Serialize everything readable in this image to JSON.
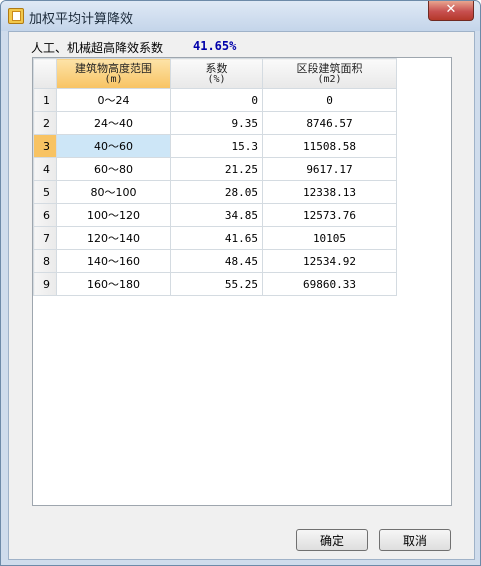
{
  "window": {
    "title": "加权平均计算降效",
    "close_glyph": "✕"
  },
  "summary": {
    "label": "人工、机械超高降效系数",
    "value": "41.65%"
  },
  "table": {
    "columns": [
      {
        "title": "建筑物高度范围",
        "unit": "(m)"
      },
      {
        "title": "系数",
        "unit": "(%)"
      },
      {
        "title": "区段建筑面积",
        "unit": "(m2)"
      }
    ],
    "rows": [
      {
        "no": "1",
        "range": "0～24",
        "coef": "0",
        "area": "0"
      },
      {
        "no": "2",
        "range": "24～40",
        "coef": "9.35",
        "area": "8746.57"
      },
      {
        "no": "3",
        "range": "40～60",
        "coef": "15.3",
        "area": "11508.58"
      },
      {
        "no": "4",
        "range": "60～80",
        "coef": "21.25",
        "area": "9617.17"
      },
      {
        "no": "5",
        "range": "80～100",
        "coef": "28.05",
        "area": "12338.13"
      },
      {
        "no": "6",
        "range": "100～120",
        "coef": "34.85",
        "area": "12573.76"
      },
      {
        "no": "7",
        "range": "120～140",
        "coef": "41.65",
        "area": "10105"
      },
      {
        "no": "8",
        "range": "140～160",
        "coef": "48.45",
        "area": "12534.92"
      },
      {
        "no": "9",
        "range": "160～180",
        "coef": "55.25",
        "area": "69860.33"
      }
    ]
  },
  "buttons": {
    "ok": "确定",
    "cancel": "取消"
  },
  "colors": {
    "selected_header": "#f8c363",
    "selected_cell": "#cde6f7",
    "summary_value": "#0000aa"
  }
}
